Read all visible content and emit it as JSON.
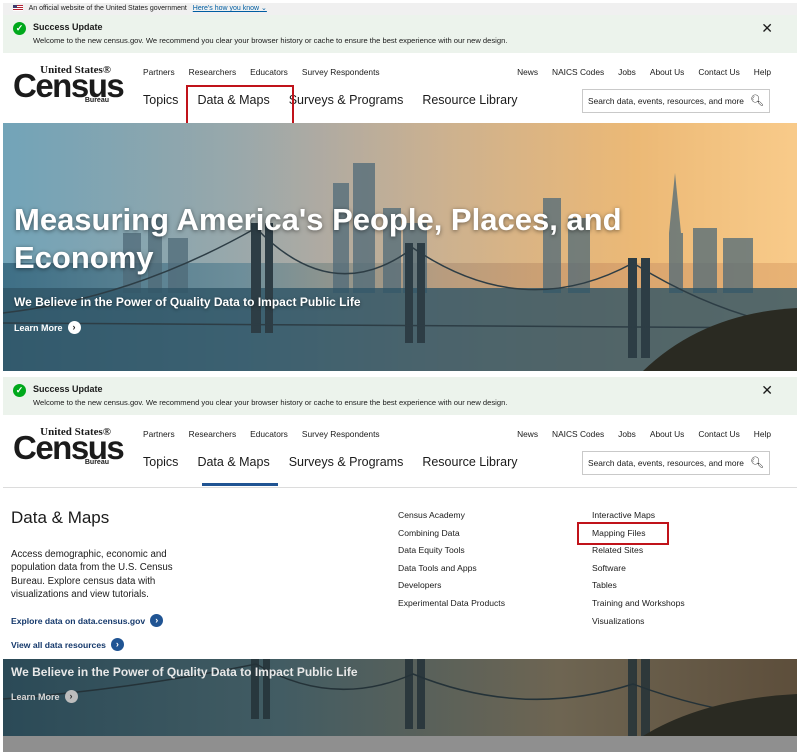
{
  "gov_banner": {
    "text": "An official website of the United States government",
    "link": "Here's how you know"
  },
  "alert": {
    "title": "Success Update",
    "message": "Welcome to the new census.gov. We recommend you clear your browser history or cache to ensure the best experience with our new design.",
    "close": "✕"
  },
  "logo": {
    "top": "United States®",
    "main": "Census",
    "bottom": "Bureau"
  },
  "utility_nav": {
    "left": [
      "Partners",
      "Researchers",
      "Educators",
      "Survey Respondents"
    ],
    "right": [
      "News",
      "NAICS Codes",
      "Jobs",
      "About Us",
      "Contact Us",
      "Help"
    ]
  },
  "main_nav": [
    "Topics",
    "Data & Maps",
    "Surveys & Programs",
    "Resource Library"
  ],
  "search": {
    "placeholder": "Search data, events, resources, and more"
  },
  "hero": {
    "title": "Measuring America's People, Places, and Economy",
    "subtitle": "We Believe in the Power of Quality Data to Impact Public Life",
    "learn_more": "Learn More"
  },
  "dropdown": {
    "title": "Data & Maps",
    "description": "Access demographic, economic and population data from the U.S. Census Bureau. Explore census data with visualizations and view tutorials.",
    "explore_link": "Explore data on data.census.gov",
    "view_all_link": "View all data resources",
    "col1": [
      "Census Academy",
      "Combining Data",
      "Data Equity Tools",
      "Data Tools and Apps",
      "Developers",
      "Experimental Data Products"
    ],
    "col2": [
      "Interactive Maps",
      "Mapping Files",
      "Related Sites",
      "Software",
      "Tables",
      "Training and Workshops",
      "Visualizations"
    ]
  },
  "colors": {
    "highlight": "#c0131a",
    "alert_bg": "#ecf3ec",
    "success": "#00a91c",
    "link": "#14386b",
    "active_underline": "#205493"
  }
}
